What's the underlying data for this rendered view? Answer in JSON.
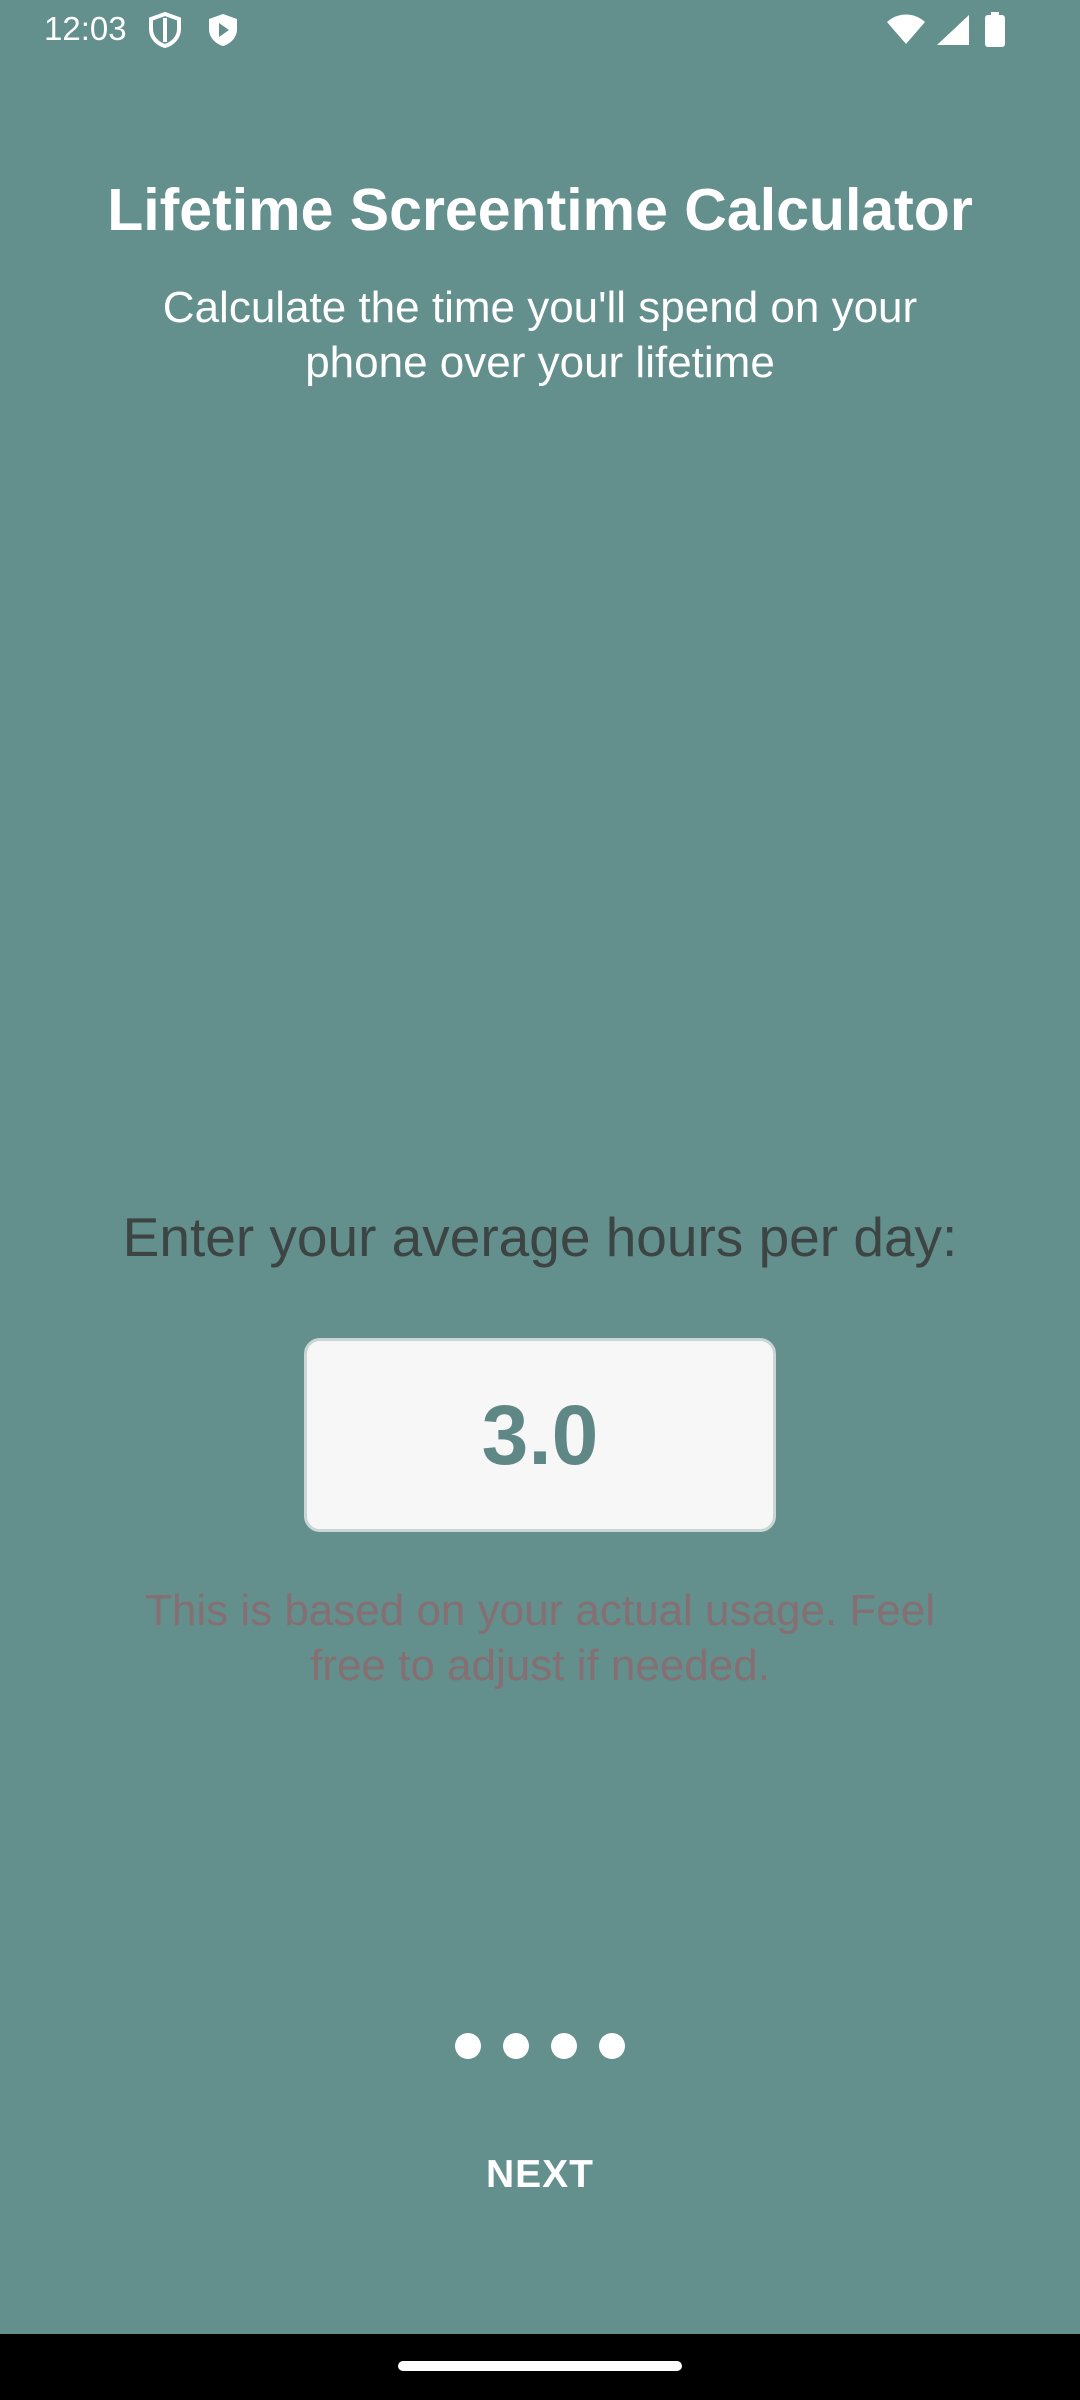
{
  "status_bar": {
    "time": "12:03",
    "icons": [
      "shield-outline-icon",
      "shield-play-icon",
      "wifi-icon",
      "signal-icon",
      "battery-icon"
    ]
  },
  "header": {
    "title": "Lifetime Screentime Calculator",
    "subtitle": "Calculate the time you'll spend on your phone over your lifetime"
  },
  "input_section": {
    "prompt": "Enter your average hours per day:",
    "hours_value": "3.0",
    "hint": "This is based on your actual usage. Feel free to adjust if needed."
  },
  "pager": {
    "total_pages": 4
  },
  "actions": {
    "next_label": "NEXT"
  },
  "colors": {
    "background": "#638f8d",
    "input_text": "#5f8785",
    "hint_text": "#866f72",
    "prompt_text": "#3c4444"
  }
}
